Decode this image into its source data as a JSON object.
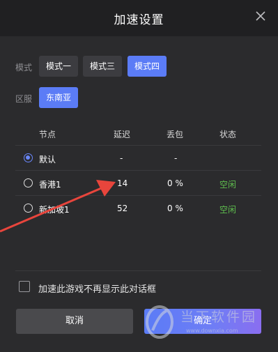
{
  "dialog": {
    "title": "加速设置",
    "mode": {
      "label": "模式",
      "options": [
        "模式一",
        "模式三",
        "模式四"
      ],
      "selected": "模式四"
    },
    "region": {
      "label": "区服",
      "options": [
        "东南亚"
      ],
      "selected": "东南亚"
    },
    "table": {
      "headers": [
        "节点",
        "延迟",
        "丢包",
        "状态"
      ],
      "rows": [
        {
          "node": "默认",
          "latency": "-",
          "loss": "-",
          "status": "",
          "selected": true
        },
        {
          "node": "香港1",
          "latency": "14",
          "loss": "0 %",
          "status": "空闲",
          "selected": false
        },
        {
          "node": "新加坡1",
          "latency": "52",
          "loss": "0 %",
          "status": "空闲",
          "selected": false
        }
      ]
    },
    "dont_show_again": "加速此游戏不再显示此对话框",
    "buttons": {
      "cancel": "取消",
      "confirm": "确定"
    }
  },
  "watermark": {
    "text": "当下软件园",
    "url": "www.downxia.com"
  },
  "colors": {
    "accent": "#5b7cf6",
    "status_idle": "#5fbf4e",
    "annotation_arrow": "#e8453c"
  }
}
